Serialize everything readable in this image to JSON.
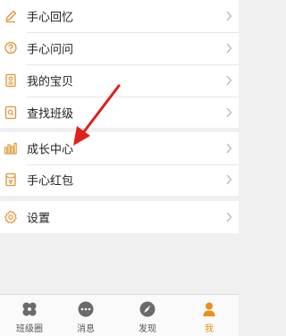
{
  "menu": {
    "items": [
      {
        "label": "手心回忆",
        "icon": "pencil-icon"
      },
      {
        "label": "手心问问",
        "icon": "question-icon"
      },
      {
        "label": "我的宝贝",
        "icon": "profile-card-icon"
      },
      {
        "label": "查找班级",
        "icon": "search-class-icon"
      },
      {
        "label": "成长中心",
        "icon": "bar-chart-icon"
      },
      {
        "label": "手心红包",
        "icon": "red-envelope-icon"
      },
      {
        "label": "设置",
        "icon": "gear-icon"
      }
    ]
  },
  "tabbar": {
    "tabs": [
      {
        "label": "班级圈",
        "icon": "clover-icon",
        "active": false
      },
      {
        "label": "消息",
        "icon": "chat-bubble-icon",
        "active": false
      },
      {
        "label": "发现",
        "icon": "rocket-icon",
        "active": false
      },
      {
        "label": "我",
        "icon": "person-icon",
        "active": true
      }
    ]
  },
  "colors": {
    "accent": "#f08c1a",
    "icon_orange": "#e0922e",
    "arrow_red": "#e0201b",
    "tab_grey": "#666666"
  }
}
